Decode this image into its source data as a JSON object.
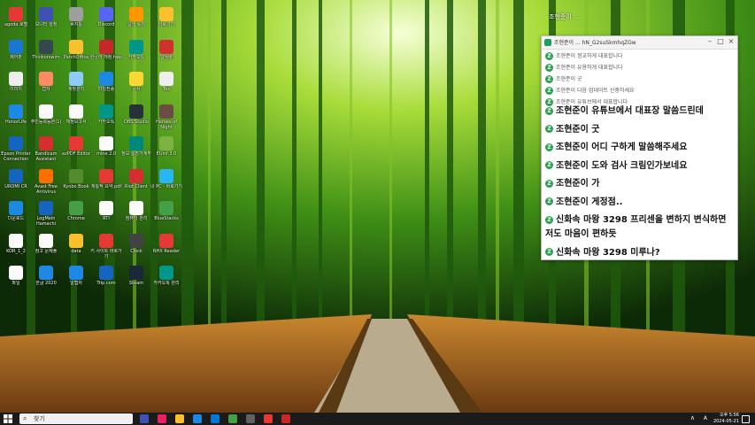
{
  "desktop_icons": [
    {
      "label": "agoda 호텔",
      "name": "agoda-icon",
      "color": "#e53935"
    },
    {
      "label": "모니터 설정",
      "name": "monitor-settings-icon",
      "color": "#3f51b5"
    },
    {
      "label": "휴지통",
      "name": "recycle-bin-icon",
      "color": "#9e9e9e"
    },
    {
      "label": "Discord",
      "name": "discord-icon",
      "color": "#5865f2"
    },
    {
      "label": "갈색 토끼",
      "name": "rabbit-icon",
      "color": "#ff9800"
    },
    {
      "label": "바로가기",
      "name": "shortcut-icon",
      "color": "#fbc02d"
    },
    {
      "label": "제어판",
      "name": "control-panel-icon",
      "color": "#1976d2"
    },
    {
      "label": "Thinkorswim",
      "name": "thinkorswim-icon",
      "color": "#37474f"
    },
    {
      "label": "PatchOffice",
      "name": "patchoffice-icon",
      "color": "#fbc02d"
    },
    {
      "label": "한국어 개정.hwp",
      "name": "hwp-icon",
      "color": "#c62828"
    },
    {
      "label": "카카오톡",
      "name": "kakao-icon",
      "color": "#009688"
    },
    {
      "label": "알툴바",
      "name": "altoolbar-icon",
      "color": "#d32f2f"
    },
    {
      "label": "이미지",
      "name": "image-icon",
      "color": "#eeeeee"
    },
    {
      "label": "캡쳐",
      "name": "capture-icon",
      "color": "#ff8a65"
    },
    {
      "label": "계정관리",
      "name": "account-icon",
      "color": "#90caf9"
    },
    {
      "label": "파일전송",
      "name": "transfer-icon",
      "color": "#1e88e5"
    },
    {
      "label": "문서",
      "name": "document-icon",
      "color": "#fdd835"
    },
    {
      "label": "Tes",
      "name": "tes-icon",
      "color": "#eeeeee"
    },
    {
      "label": "HonorLife",
      "name": "honorlife-icon",
      "color": "#1e88e5"
    },
    {
      "label": "주민등록등본(1)",
      "name": "pdf-icon",
      "color": "#fafafa"
    },
    {
      "label": "재정보고서",
      "name": "report-icon",
      "color": "#fafafa"
    },
    {
      "label": "카카오톡",
      "name": "kakao2-icon",
      "color": "#009688"
    },
    {
      "label": "OBS Studio",
      "name": "obs-icon",
      "color": "#263238"
    },
    {
      "label": "Heroes of Night",
      "name": "heroes-icon",
      "color": "#6d4c41"
    },
    {
      "label": "Epson Printer Connection",
      "name": "epson-icon",
      "color": "#1565c0"
    },
    {
      "label": "Bandicam Assistant",
      "name": "bandicam-icon",
      "color": "#d32f2f"
    },
    {
      "label": "ezPDF Editor",
      "name": "ezpdf-icon",
      "color": "#e53935"
    },
    {
      "label": "mine 2.0",
      "name": "mine-icon",
      "color": "#fafafa"
    },
    {
      "label": "정보 통장가계부",
      "name": "ledger-icon",
      "color": "#00897b"
    },
    {
      "label": "EUinf 3.0",
      "name": "euinf-icon",
      "color": "#7cb342"
    },
    {
      "label": "UROMI CR",
      "name": "uromi-icon",
      "color": "#1565c0"
    },
    {
      "label": "Avast Free Antivirus",
      "name": "avast-icon",
      "color": "#ff6f00"
    },
    {
      "label": "Kyobo Book",
      "name": "kyobo-icon",
      "color": "#558b2f"
    },
    {
      "label": "계통적 요약.pdf",
      "name": "pdf2-icon",
      "color": "#e53935"
    },
    {
      "label": "Riot Client",
      "name": "riot-icon",
      "color": "#d32f2f"
    },
    {
      "label": "내 PC - 바로가기",
      "name": "mypc-icon",
      "color": "#29b6f6"
    },
    {
      "label": "다운로드",
      "name": "download-icon",
      "color": "#1e88e5"
    },
    {
      "label": "LogMein Hamachi",
      "name": "hamachi-icon",
      "color": "#1565c0"
    },
    {
      "label": "Chrome",
      "name": "chrome-icon",
      "color": "#43a047"
    },
    {
      "label": "RTI",
      "name": "rti-icon",
      "color": "#fafafa"
    },
    {
      "label": "컴퓨터 관리",
      "name": "computer-mgmt-icon",
      "color": "#fafafa"
    },
    {
      "label": "BlueStacks",
      "name": "bluestacks-icon",
      "color": "#43a047"
    },
    {
      "label": "KOR_1_2",
      "name": "kor-icon",
      "color": "#fafafa"
    },
    {
      "label": "참고 문제풀",
      "name": "notes-icon",
      "color": "#fafafa"
    },
    {
      "label": "data",
      "name": "data-folder-icon",
      "color": "#fbc02d"
    },
    {
      "label": "키 사이트 바로가기",
      "name": "site-icon",
      "color": "#e53935"
    },
    {
      "label": "Clock",
      "name": "clock-icon",
      "color": "#424242"
    },
    {
      "label": "NHX Reader",
      "name": "reader-icon",
      "color": "#e53935"
    },
    {
      "label": "파일",
      "name": "file-icon",
      "color": "#fafafa"
    },
    {
      "label": "한글 2020",
      "name": "hangul-icon",
      "color": "#1e88e5"
    },
    {
      "label": "알캡처",
      "name": "alcapture-icon",
      "color": "#1e88e5"
    },
    {
      "label": "Trip.com",
      "name": "trip-icon",
      "color": "#1565c0"
    },
    {
      "label": "Steam",
      "name": "steam-icon",
      "color": "#1b2838"
    },
    {
      "label": "카카오톡 관리",
      "name": "kakao3-icon",
      "color": "#009688"
    }
  ],
  "overlay_top": "조현준이 ...",
  "chat": {
    "title": "조현준이 ... hN_G2suSkmhqZGw",
    "controls": {
      "min": "–",
      "max": "□",
      "close": "×"
    },
    "badge": "Z",
    "small_messages": [
      "조현준이 정교하게 대표합니다",
      "조현준이 유용하게 대표합니다",
      "조현준이 굿",
      "조현준이 다음 업데이트 신중하세요",
      "조현준이 유튜브에서 대표합니다"
    ],
    "messages": [
      "조현준이 유튜브에서 대표장 말씀드린데",
      "조현준이 굿",
      "조현준이 어디 구하게 말씀해주세요",
      "조현준이 도와 검사 크림인가보네요",
      "조현준이 가",
      "조현준이 게정점..",
      "신화속 마왕 3298  프리센을 변하지 변식하면",
      "저도 마음이 편하듯",
      "신화속 마왕 3298  미루나?"
    ]
  },
  "taskbar": {
    "search_placeholder": "찾기",
    "lang": "A",
    "time": "오후 5:56",
    "date": "2024-05-21"
  }
}
